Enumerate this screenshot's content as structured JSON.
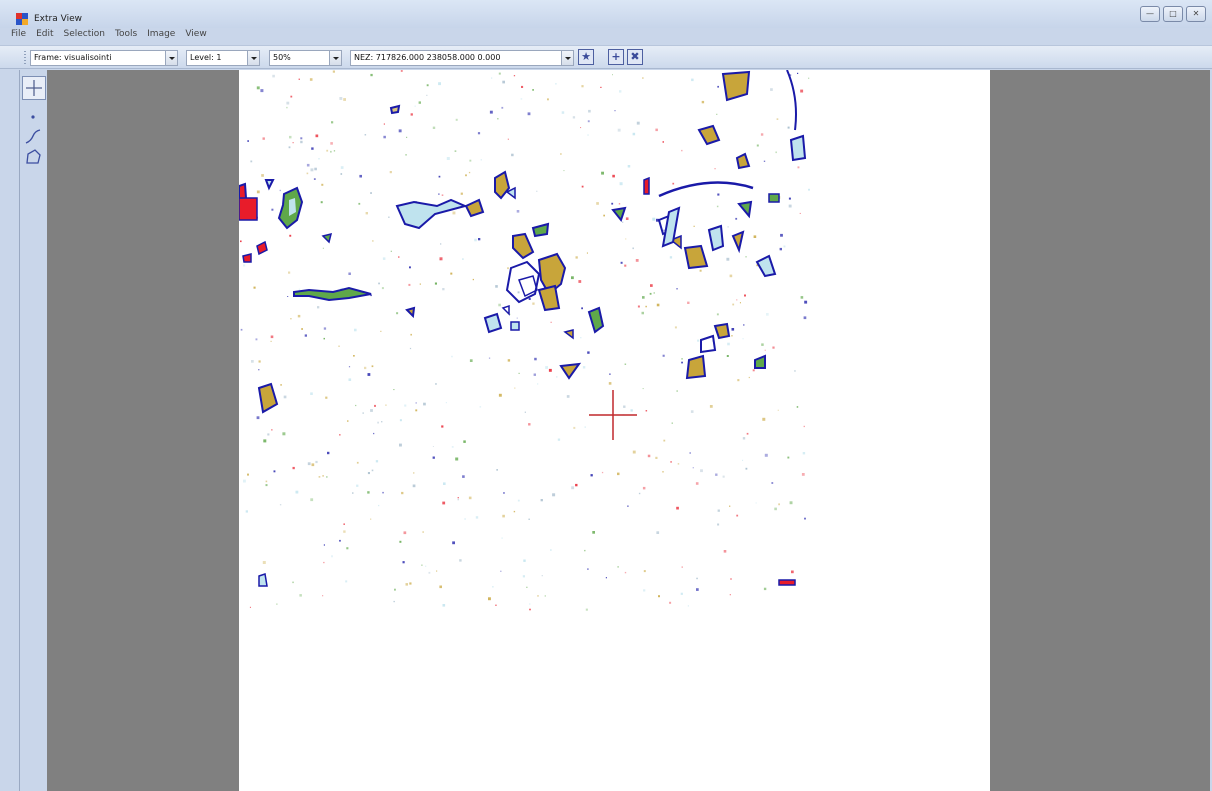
{
  "window": {
    "title": "Extra View",
    "icon": "app-icon",
    "controls": [
      "minimize-icon",
      "maximize-icon",
      "close-icon"
    ]
  },
  "menu": [
    "File",
    "Edit",
    "Selection",
    "Tools",
    "Image",
    "View"
  ],
  "toolbar": {
    "frame": "Frame: visualisointi",
    "level": "Level: 1",
    "zoom": "50%",
    "coordinates": "NEZ: 717826.000 238058.000 0.000",
    "buttons": [
      "star-icon",
      "plus-icon",
      "crossed-box-icon"
    ]
  },
  "tools": [
    {
      "name": "cursor-tool",
      "active": true
    },
    {
      "name": "point-tool",
      "active": false
    },
    {
      "name": "line-tool",
      "active": false
    },
    {
      "name": "polygon-tool",
      "active": false
    }
  ],
  "colors": {
    "window_bg": "#c9d6ea",
    "canvas_bg": "#808080",
    "page_bg": "#ffffff",
    "outline": "#1a1aa8",
    "fill_olive": "#c8a53a",
    "fill_green": "#5fa84a",
    "fill_light": "#bfe3ee",
    "fill_red": "#e81c2a",
    "crosshair": "#c0282c"
  }
}
